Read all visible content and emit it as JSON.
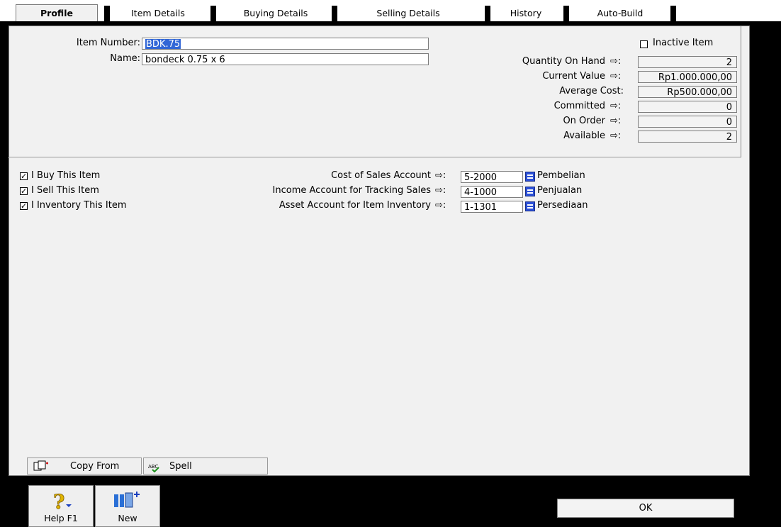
{
  "tabs": [
    "Profile",
    "Item Details",
    "Buying Details",
    "Selling Details",
    "History",
    "Auto-Build"
  ],
  "item": {
    "number_label": "Item Number:",
    "number_value": "BDK.75",
    "name_label": "Name:",
    "name_value": "bondeck 0.75 x 6"
  },
  "inactive": {
    "label": "Inactive Item",
    "checked": false
  },
  "stats": [
    {
      "label": "Quantity On Hand",
      "value": "2",
      "arrow": true
    },
    {
      "label": "Current Value",
      "value": "Rp1.000.000,00",
      "arrow": true
    },
    {
      "label": "Average Cost:",
      "value": "Rp500.000,00",
      "arrow": false
    },
    {
      "label": "Committed",
      "value": "0",
      "arrow": true
    },
    {
      "label": "On Order",
      "value": "0",
      "arrow": true
    },
    {
      "label": "Available",
      "value": "2",
      "arrow": true
    }
  ],
  "flags": [
    {
      "label": "I Buy This Item",
      "checked": true
    },
    {
      "label": "I Sell This Item",
      "checked": true
    },
    {
      "label": "I Inventory This Item",
      "checked": true
    }
  ],
  "accounts": [
    {
      "label": "Cost of Sales Account",
      "code": "5-2000",
      "name": "Pembelian"
    },
    {
      "label": "Income Account for Tracking Sales",
      "code": "4-1000",
      "name": "Penjualan"
    },
    {
      "label": "Asset Account for Item Inventory",
      "code": "1-1301",
      "name": "Persediaan"
    }
  ],
  "buttons": {
    "copy_from": "Copy From",
    "spell": "Spell",
    "help": "Help F1",
    "new": "New",
    "ok": "OK"
  },
  "arrow_glyph": "⇨:"
}
